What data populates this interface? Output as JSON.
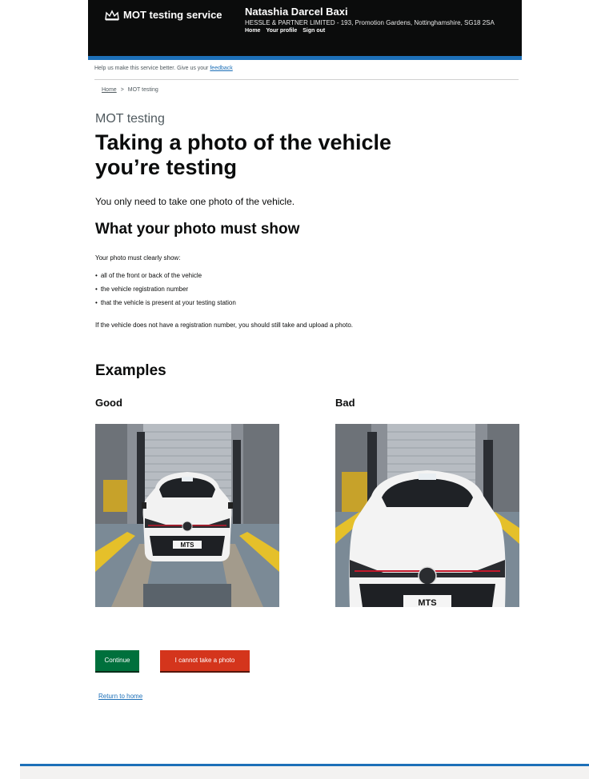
{
  "header": {
    "service_name": "MOT testing service",
    "user_name": "Natashia Darcel Baxi",
    "user_address": "HESSLE & PARTNER LIMITED - 193, Promotion Gardens, Nottinghamshire, SG18 2SA",
    "nav": [
      "Home",
      "Your profile",
      "Sign out"
    ],
    "brand_icon": "crown-icon"
  },
  "feedback": {
    "text": "Help us make this service better. Give us your",
    "link": "feedback"
  },
  "breadcrumb": {
    "home": "Home",
    "separator": ">",
    "current": "MOT testing"
  },
  "main": {
    "caption": "MOT testing",
    "title": "Taking a photo of the vehicle you’re testing",
    "lead": "You only need to take one photo of the vehicle.",
    "section_heading": "What your photo must show",
    "intro": "Your photo must clearly show:",
    "bullets": [
      "all of the front or back of the vehicle",
      "the vehicle registration number",
      "that the vehicle is present at your testing station"
    ],
    "note": "If the vehicle does not have a registration number, you should still take and upload a photo.",
    "examples_heading": "Examples",
    "good_label": "Good",
    "bad_label": "Bad",
    "good_plate": "MTS",
    "bad_plate": "MTS"
  },
  "actions": {
    "continue_label": "Continue",
    "cannot_label": "I cannot take a photo",
    "return_link": "Return to home"
  },
  "colors": {
    "header_bg": "#0b0c0c",
    "accent_blue": "#1d70b8",
    "continue_green": "#00703c",
    "cannot_red": "#d4351c"
  }
}
